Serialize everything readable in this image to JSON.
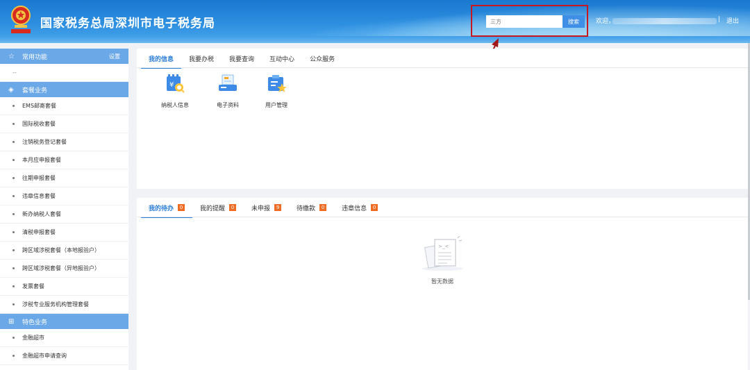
{
  "header": {
    "title": "国家税务总局深圳市电子税务局",
    "search_placeholder": "三方",
    "search_button": "搜索",
    "welcome": "欢迎",
    "divider": "|",
    "logout": "退出"
  },
  "sidebar": {
    "common": {
      "label": "常用功能",
      "setting": "设置",
      "icon": "star-icon",
      "empty": "--"
    },
    "package": {
      "label": "套餐业务",
      "icon": "layers-icon",
      "items": [
        "EMS邮寄套餐",
        "国际税收套餐",
        "注销税务登记套餐",
        "本月应申报套餐",
        "往期申报套餐",
        "违章信息套餐",
        "新办纳税人套餐",
        "清税申报套餐",
        "跨区域涉税套餐（本地报验户）",
        "跨区域涉税套餐（异地报验户）",
        "发票套餐",
        "涉税专业服务机构管理套餐"
      ]
    },
    "special": {
      "label": "特色业务",
      "icon": "grid-icon",
      "items": [
        "金融超市",
        "金融超市申请查询"
      ]
    }
  },
  "info_panel": {
    "tabs": [
      "我的信息",
      "我要办税",
      "我要查询",
      "互动中心",
      "公众服务"
    ],
    "active_tab": 0,
    "quick_links": [
      {
        "label": "纳税人信息",
        "icon": "taxpayer-info-icon"
      },
      {
        "label": "电子资料",
        "icon": "e-document-icon"
      },
      {
        "label": "用户管理",
        "icon": "user-management-icon"
      }
    ]
  },
  "todo_panel": {
    "tabs": [
      {
        "label": "我的待办",
        "count": "0"
      },
      {
        "label": "我的提醒",
        "count": "0"
      },
      {
        "label": "未申报",
        "count": "9"
      },
      {
        "label": "待缴款",
        "count": "0"
      },
      {
        "label": "违章信息",
        "count": "0"
      }
    ],
    "active_tab": 0,
    "empty_text": "暂无数据"
  },
  "colors": {
    "accent": "#2d7fd8",
    "sidebar_header": "#6ba8e8",
    "badge": "#f06c23",
    "highlight": "#c8161e"
  }
}
